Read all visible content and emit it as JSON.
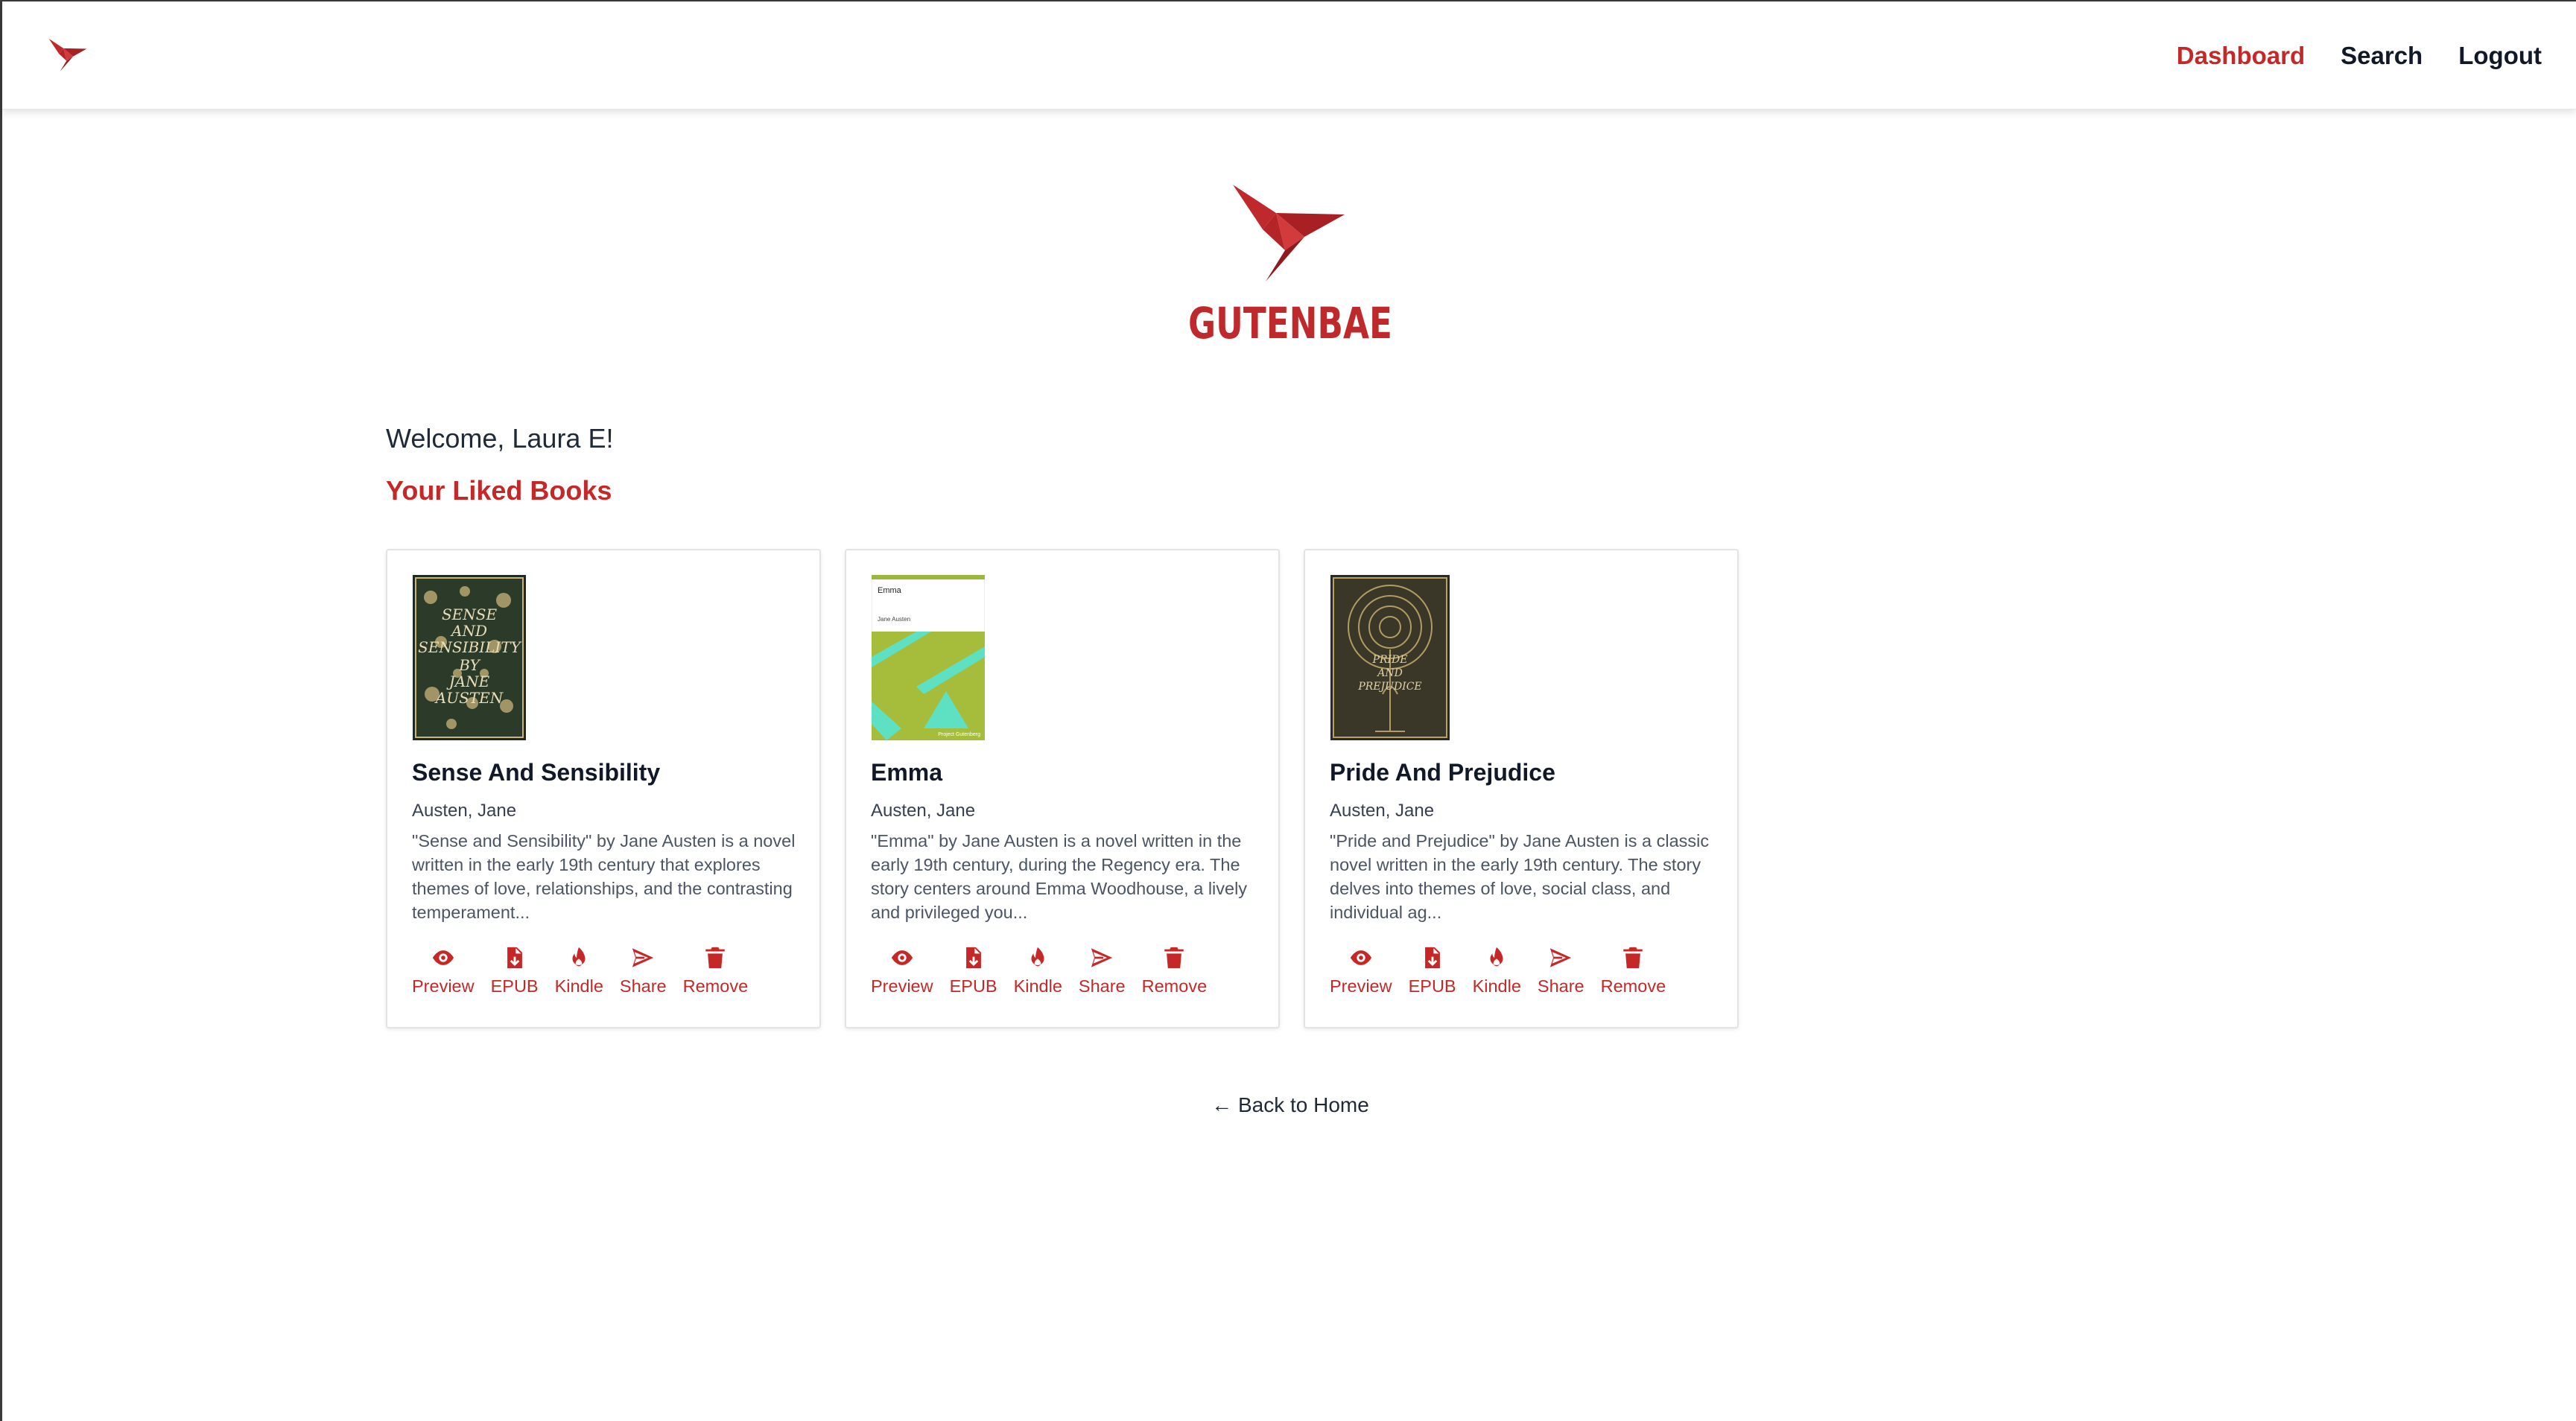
{
  "nav": {
    "links": [
      {
        "label": "Dashboard",
        "active": true
      },
      {
        "label": "Search",
        "active": false
      },
      {
        "label": "Logout",
        "active": false
      }
    ]
  },
  "brand": {
    "name": "GUTENBAE",
    "accent_color": "#c62828"
  },
  "welcome": "Welcome, Laura E!",
  "section_title": "Your Liked Books",
  "books": [
    {
      "title": "Sense And Sensibility",
      "author": "Austen, Jane",
      "description": "\"Sense and Sensibility\" by Jane Austen is a novel written in the early 19th century that explores themes of love, relationships, and the contrasting temperament...",
      "cover_title_text": "SENSE AND SENSIBILITY BY JANE AUSTEN"
    },
    {
      "title": "Emma",
      "author": "Austen, Jane",
      "description": "\"Emma\" by Jane Austen is a novel written in the early 19th century, during the Regency era. The story centers around Emma Woodhouse, a lively and privileged you...",
      "cover_title_text": "Emma",
      "cover_author_text": "Jane Austen",
      "cover_publisher_text": "Project Gutenberg"
    },
    {
      "title": "Pride And Prejudice",
      "author": "Austen, Jane",
      "description": "\"Pride and Prejudice\" by Jane Austen is a classic novel written in the early 19th century. The story delves into themes of love, social class, and individual ag...",
      "cover_title_text": "PRIDE AND PREJUDICE"
    }
  ],
  "actions": [
    {
      "label": "Preview",
      "icon": "eye-icon"
    },
    {
      "label": "EPUB",
      "icon": "file-download-icon"
    },
    {
      "label": "Kindle",
      "icon": "flame-icon"
    },
    {
      "label": "Share",
      "icon": "send-icon"
    },
    {
      "label": "Remove",
      "icon": "trash-icon"
    }
  ],
  "back_link": "← Back to Home"
}
